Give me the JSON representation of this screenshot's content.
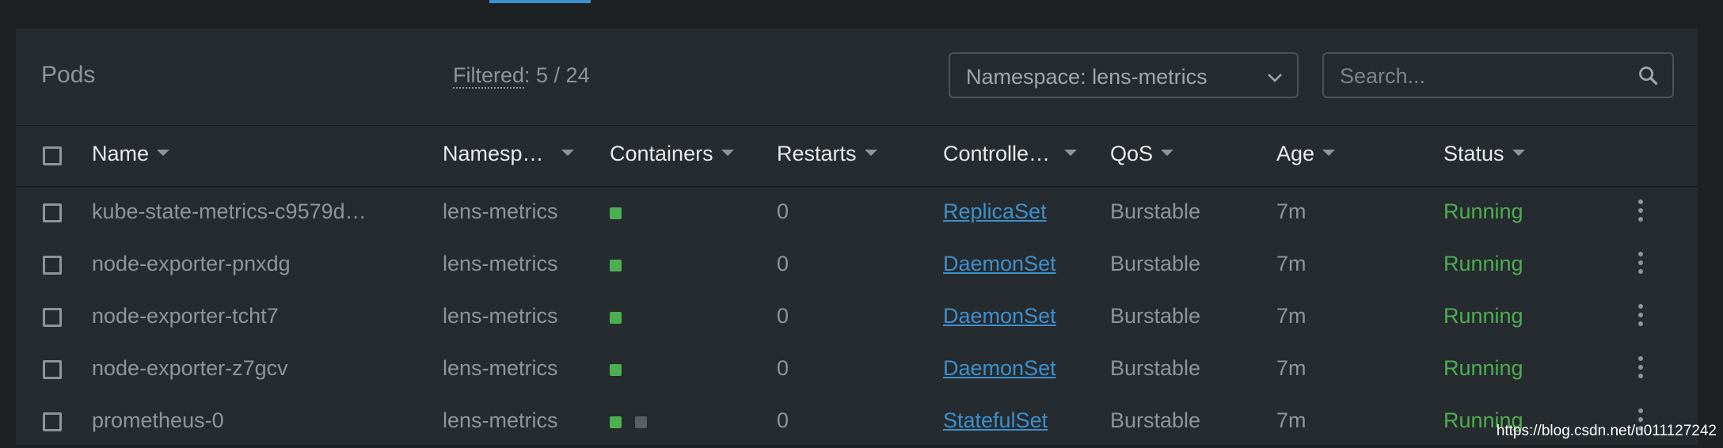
{
  "header": {
    "title": "Pods",
    "filtered_label": "Filtered",
    "filtered_value": ": 5 / 24",
    "namespace_select": "Namespace: lens-metrics",
    "search_placeholder": "Search..."
  },
  "columns": [
    "Name",
    "Namesp…",
    "Containers",
    "Restarts",
    "Controlle…",
    "QoS",
    "Age",
    "Status"
  ],
  "rows": [
    {
      "name": "kube-state-metrics-c9579d…",
      "namespace": "lens-metrics",
      "containers": [
        "running"
      ],
      "restarts": "0",
      "controller": "ReplicaSet",
      "qos": "Burstable",
      "age": "7m",
      "status": "Running"
    },
    {
      "name": "node-exporter-pnxdg",
      "namespace": "lens-metrics",
      "containers": [
        "running"
      ],
      "restarts": "0",
      "controller": "DaemonSet",
      "qos": "Burstable",
      "age": "7m",
      "status": "Running"
    },
    {
      "name": "node-exporter-tcht7",
      "namespace": "lens-metrics",
      "containers": [
        "running"
      ],
      "restarts": "0",
      "controller": "DaemonSet",
      "qos": "Burstable",
      "age": "7m",
      "status": "Running"
    },
    {
      "name": "node-exporter-z7gcv",
      "namespace": "lens-metrics",
      "containers": [
        "running"
      ],
      "restarts": "0",
      "controller": "DaemonSet",
      "qos": "Burstable",
      "age": "7m",
      "status": "Running"
    },
    {
      "name": "prometheus-0",
      "namespace": "lens-metrics",
      "containers": [
        "running",
        "terminated"
      ],
      "restarts": "0",
      "controller": "StatefulSet",
      "qos": "Burstable",
      "age": "7m",
      "status": "Running"
    }
  ],
  "colors": {
    "running": "#4caf50",
    "terminated": "#5a5f64",
    "link": "#3d90ce",
    "accent": "#3d90ce"
  },
  "icons": {
    "namespace_dropdown": "chevron-down-icon",
    "search": "search-icon",
    "row_menu": "more-vertical-icon"
  },
  "watermark": "https://blog.csdn.net/u011127242"
}
